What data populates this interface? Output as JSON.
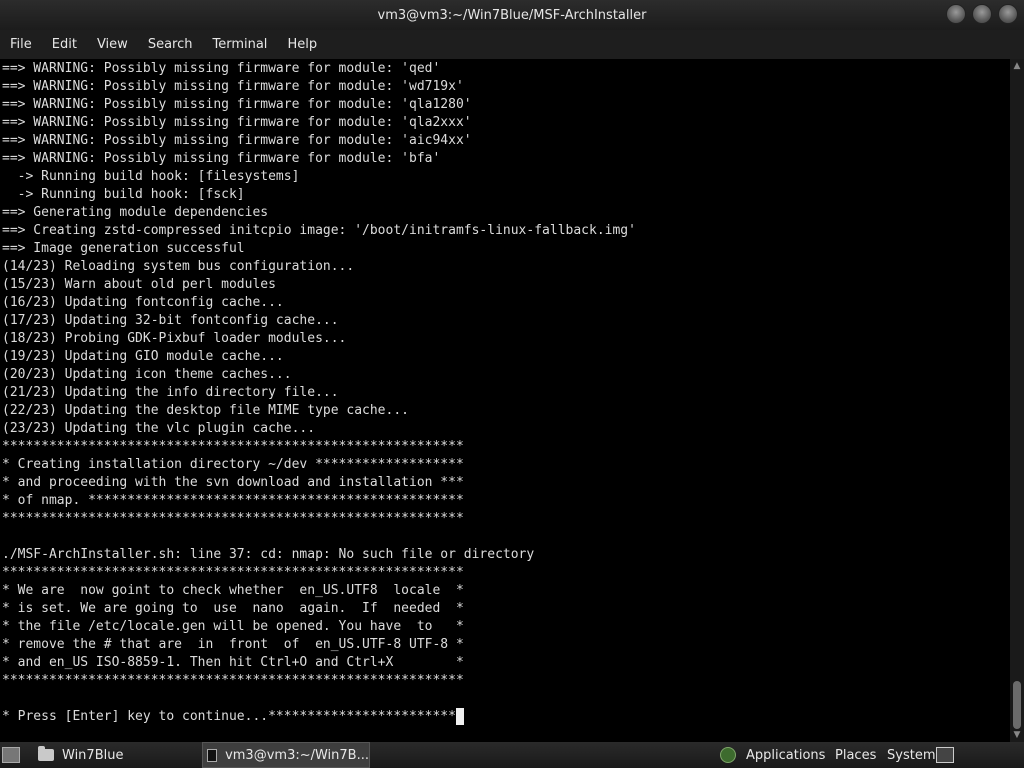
{
  "window": {
    "title": "vm3@vm3:~/Win7Blue/MSF-ArchInstaller"
  },
  "menu": [
    "File",
    "Edit",
    "View",
    "Search",
    "Terminal",
    "Help"
  ],
  "terminal": {
    "lines": [
      "==> WARNING: Possibly missing firmware for module: 'qed'",
      "==> WARNING: Possibly missing firmware for module: 'wd719x'",
      "==> WARNING: Possibly missing firmware for module: 'qla1280'",
      "==> WARNING: Possibly missing firmware for module: 'qla2xxx'",
      "==> WARNING: Possibly missing firmware for module: 'aic94xx'",
      "==> WARNING: Possibly missing firmware for module: 'bfa'",
      "  -> Running build hook: [filesystems]",
      "  -> Running build hook: [fsck]",
      "==> Generating module dependencies",
      "==> Creating zstd-compressed initcpio image: '/boot/initramfs-linux-fallback.img'",
      "==> Image generation successful",
      "(14/23) Reloading system bus configuration...",
      "(15/23) Warn about old perl modules",
      "(16/23) Updating fontconfig cache...",
      "(17/23) Updating 32-bit fontconfig cache...",
      "(18/23) Probing GDK-Pixbuf loader modules...",
      "(19/23) Updating GIO module cache...",
      "(20/23) Updating icon theme caches...",
      "(21/23) Updating the info directory file...",
      "(22/23) Updating the desktop file MIME type cache...",
      "(23/23) Updating the vlc plugin cache...",
      "***********************************************************",
      "* Creating installation directory ~/dev *******************",
      "* and proceeding with the svn download and installation ***",
      "* of nmap. ************************************************",
      "***********************************************************",
      "",
      "./MSF-ArchInstaller.sh: line 37: cd: nmap: No such file or directory",
      "***********************************************************",
      "* We are  now goint to check whether  en_US.UTF8  locale  *",
      "* is set. We are going to  use  nano  again.  If  needed  *",
      "* the file /etc/locale.gen will be opened. You have  to   *",
      "* remove the # that are  in  front  of  en_US.UTF-8 UTF-8 *",
      "* and en_US ISO-8859-1. Then hit Ctrl+O and Ctrl+X        *",
      "***********************************************************",
      "",
      "* Press [Enter] key to continue...************************"
    ]
  },
  "taskbar": {
    "folder_task": "Win7Blue",
    "terminal_task": "vm3@vm3:~/Win7B...",
    "applications": "Applications",
    "places": "Places",
    "system": "System"
  }
}
